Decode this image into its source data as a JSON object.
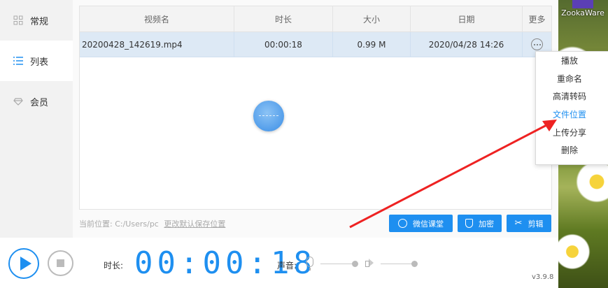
{
  "sidebar": {
    "items": [
      {
        "label": "常规",
        "icon": "grid-icon"
      },
      {
        "label": "列表",
        "icon": "list-icon"
      },
      {
        "label": "会员",
        "icon": "diamond-icon"
      }
    ],
    "active": "列表"
  },
  "table": {
    "headers": [
      "视频名",
      "时长",
      "大小",
      "日期",
      "更多"
    ],
    "rows": [
      {
        "name": "20200428_142619.mp4",
        "duration": "00:00:18",
        "size": "0.99 M",
        "date": "2020/04/28 14:26"
      }
    ]
  },
  "path": {
    "label": "当前位置:",
    "value": "C:/Users/pc",
    "change_link": "更改默认保存位置"
  },
  "actions": {
    "weixin": "微信课堂",
    "encrypt": "加密",
    "cut": "剪辑"
  },
  "context_menu": {
    "items": [
      "播放",
      "重命名",
      "高清转码",
      "文件位置",
      "上传分享",
      "删除"
    ],
    "highlighted": "文件位置"
  },
  "player": {
    "duration_label": "时长:",
    "timer": "00:00:18",
    "volume_label": "声音:",
    "version": "v3.9.8"
  },
  "desktop": {
    "icon_label": "ZookaWare"
  },
  "colors": {
    "accent": "#1e8ff0",
    "row_selected": "#dde9f5",
    "arrow": "#ee2222"
  }
}
